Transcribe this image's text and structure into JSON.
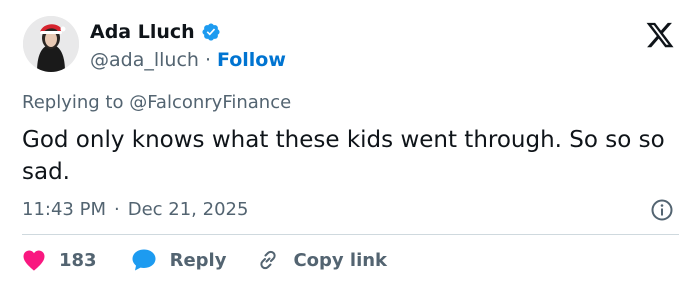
{
  "author": {
    "display_name": "Ada Lluch",
    "handle": "@ada_lluch",
    "separator": "·",
    "follow_label": "Follow"
  },
  "tweet": {
    "replying_prefix": "Replying to",
    "replying_to": "@FalconryFinance",
    "text": "God only knows what these kids went through. So so so sad.",
    "time": "11:43 PM",
    "separator": "·",
    "date": "Dec 21, 2025"
  },
  "actions": {
    "like_count": "183",
    "reply_label": "Reply",
    "copy_link_label": "Copy link"
  },
  "colors": {
    "accent": "#0074d1",
    "like": "#f91880",
    "reply": "#1d9bf0",
    "muted": "#536471",
    "text": "#0f1419"
  },
  "icons": {
    "verified": "verified-badge-icon",
    "logo": "x-logo-icon",
    "info": "info-icon",
    "like": "heart-icon",
    "reply": "speech-bubble-icon",
    "copy_link": "link-icon"
  }
}
